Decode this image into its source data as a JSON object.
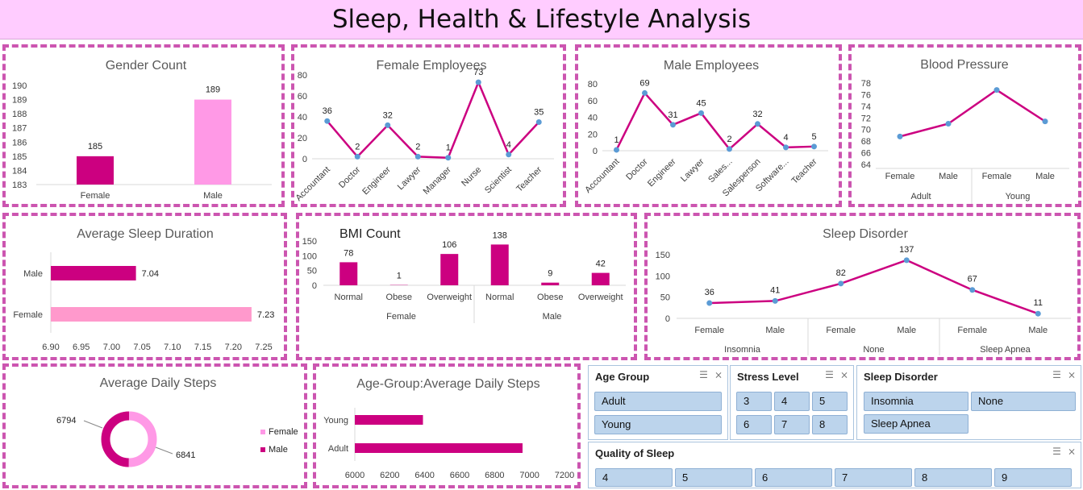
{
  "dashboard_title": "Sleep, Health & Lifestyle Analysis",
  "colors": {
    "magenta": "#cc0080",
    "pink": "#ff99e6",
    "light_pink": "#ff99cc",
    "marker": "#5b9bd5"
  },
  "chart_data": [
    {
      "id": "gender_count",
      "type": "bar",
      "title": "Gender Count",
      "categories": [
        "Female",
        "Male"
      ],
      "values": [
        185,
        189
      ],
      "ylim": [
        183,
        190
      ],
      "yticks": [
        "183",
        "184",
        "185",
        "186",
        "187",
        "188",
        "189",
        "190"
      ]
    },
    {
      "id": "female_employees",
      "type": "line",
      "title": "Female Employees",
      "categories": [
        "Accountant",
        "Doctor",
        "Engineer",
        "Lawyer",
        "Manager",
        "Nurse",
        "Scientist",
        "Teacher"
      ],
      "values": [
        36,
        2,
        32,
        2,
        1,
        73,
        4,
        35
      ],
      "ylim": [
        0,
        80
      ],
      "yticks": [
        "0",
        "20",
        "40",
        "60",
        "80"
      ]
    },
    {
      "id": "male_employees",
      "type": "line",
      "title": "Male Employees",
      "categories": [
        "Accountant",
        "Doctor",
        "Engineer",
        "Lawyer",
        "Sales...",
        "Salesperson",
        "Software...",
        "Teacher"
      ],
      "values": [
        1,
        69,
        31,
        45,
        2,
        32,
        4,
        5
      ],
      "ylim": [
        0,
        80
      ],
      "yticks": [
        "0",
        "20",
        "40",
        "60",
        "80"
      ]
    },
    {
      "id": "blood_pressure",
      "type": "line",
      "title": "Blood Pressure",
      "categories": [
        "Female",
        "Male",
        "Female",
        "Male"
      ],
      "groups": [
        "Adult",
        "Young"
      ],
      "values": [
        68.8,
        71,
        76.8,
        71.4
      ],
      "ylim": [
        64,
        78
      ],
      "yticks": [
        "64",
        "66",
        "68",
        "70",
        "72",
        "74",
        "76",
        "78"
      ]
    },
    {
      "id": "avg_sleep",
      "type": "bar",
      "title": "Average Sleep Duration",
      "categories": [
        "Male",
        "Female"
      ],
      "values": [
        7.04,
        7.23
      ],
      "xlim": [
        6.9,
        7.25
      ],
      "xticks": [
        "6.90",
        "6.95",
        "7.00",
        "7.05",
        "7.10",
        "7.15",
        "7.20",
        "7.25"
      ]
    },
    {
      "id": "bmi_count",
      "type": "bar",
      "title": "BMI Count",
      "categories": [
        "Normal",
        "Obese",
        "Overweight",
        "Normal",
        "Obese",
        "Overweight"
      ],
      "groups": [
        "Female",
        "Male"
      ],
      "values": [
        78,
        1,
        106,
        138,
        9,
        42
      ],
      "ylim": [
        0,
        150
      ],
      "yticks": [
        "0",
        "50",
        "100",
        "150"
      ]
    },
    {
      "id": "sleep_disorder",
      "type": "line",
      "title": "Sleep Disorder",
      "categories": [
        "Female",
        "Male",
        "Female",
        "Male",
        "Female",
        "Male"
      ],
      "groups": [
        "Insomnia",
        "None",
        "Sleep Apnea"
      ],
      "values": [
        36,
        41,
        82,
        137,
        67,
        11
      ],
      "ylim": [
        0,
        150
      ],
      "yticks": [
        "0",
        "50",
        "100",
        "150"
      ]
    },
    {
      "id": "avg_steps",
      "type": "pie",
      "title": "Average Daily Steps",
      "series": [
        {
          "name": "Female",
          "value": 6841
        },
        {
          "name": "Male",
          "value": 6794
        }
      ]
    },
    {
      "id": "age_steps",
      "type": "bar",
      "title": "Age-Group:Average Daily Steps",
      "categories": [
        "Young",
        "Adult"
      ],
      "values": [
        6390,
        6960
      ],
      "xlim": [
        6000,
        7200
      ],
      "xticks": [
        "6000",
        "6200",
        "6400",
        "6600",
        "6800",
        "7000",
        "7200"
      ]
    }
  ],
  "slicers": {
    "age_group": {
      "title": "Age Group",
      "items": [
        "Adult",
        "Young"
      ]
    },
    "stress_level": {
      "title": "Stress Level",
      "items": [
        "3",
        "4",
        "5",
        "6",
        "7",
        "8"
      ]
    },
    "sleep_disorder": {
      "title": "Sleep Disorder",
      "items": [
        "Insomnia",
        "None",
        "Sleep Apnea"
      ]
    },
    "quality_of_sleep": {
      "title": "Quality of Sleep",
      "items": [
        "4",
        "5",
        "6",
        "7",
        "8",
        "9"
      ]
    }
  },
  "slicer_icons": [
    "multi-select-icon",
    "clear-filter-icon"
  ]
}
